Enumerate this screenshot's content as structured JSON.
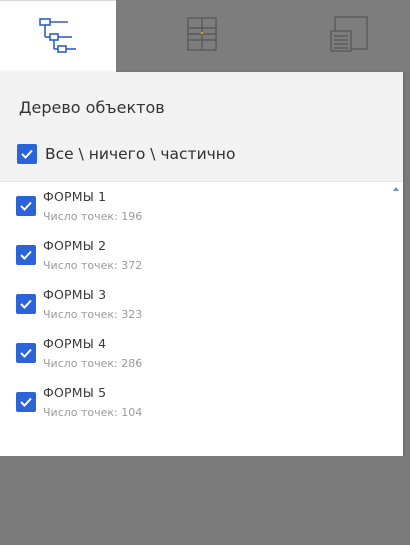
{
  "tabs": [
    {
      "icon": "tree-icon",
      "active": true
    },
    {
      "icon": "grid-icon",
      "active": false
    },
    {
      "icon": "layers-panel-icon",
      "active": false
    }
  ],
  "panel": {
    "title": "Дерево объектов",
    "master_checkbox": {
      "label": "Все \\ ничего \\ частично",
      "checked": true
    },
    "items": [
      {
        "title": "ФОРМЫ 1",
        "subtitle": "Число точек: 196",
        "checked": true
      },
      {
        "title": "ФОРМЫ 2",
        "subtitle": "Число точек: 372",
        "checked": true
      },
      {
        "title": "ФОРМЫ 3",
        "subtitle": "Число точек: 323",
        "checked": true
      },
      {
        "title": "ФОРМЫ 4",
        "subtitle": "Число точек: 286",
        "checked": true
      },
      {
        "title": "ФОРМЫ 5",
        "subtitle": "Число точек: 104",
        "checked": true
      }
    ]
  },
  "colors": {
    "accent": "#2b63d9",
    "tab_icon_active": "#2f5fc4",
    "backdrop": "#7a7a7a"
  }
}
